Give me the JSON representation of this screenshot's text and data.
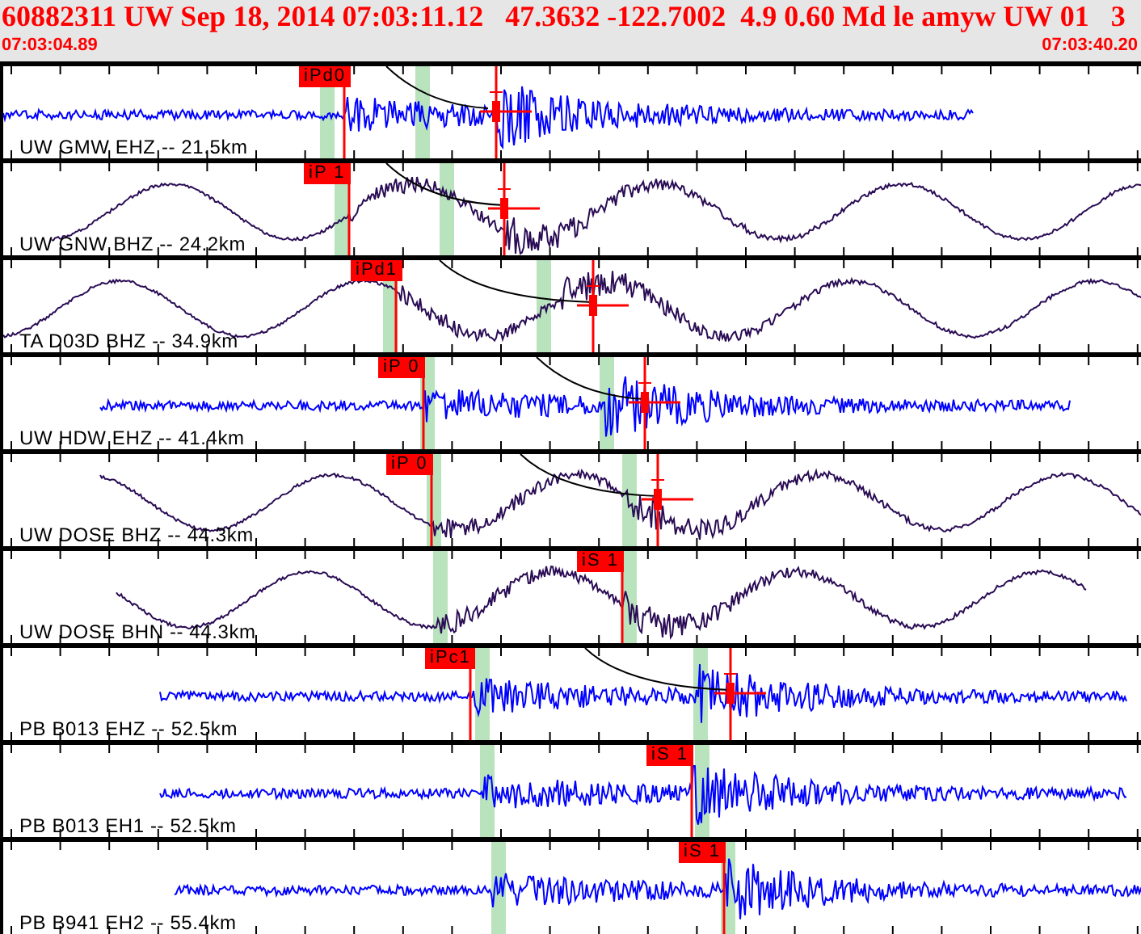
{
  "header": {
    "title": "60882311 UW Sep 18, 2014 07:03:11.12   47.3632 -122.7002  4.9 0.60 Md le amyw UW 01   3",
    "start_time": "07:03:04.89",
    "end_time": "07:03:40.20"
  },
  "traces": [
    {
      "label": "UW GMW EHZ -- 21.5km",
      "kind": "short-period",
      "color": "#0000ff",
      "pick": "iPd0"
    },
    {
      "label": "UW GNW BHZ -- 24.2km",
      "kind": "broadband",
      "color": "#2a0c55",
      "pick": "iP 1"
    },
    {
      "label": "TA D03D BHZ -- 34.9km",
      "kind": "broadband",
      "color": "#2a0c55",
      "pick": "iPd1"
    },
    {
      "label": "UW HDW EHZ -- 41.4km",
      "kind": "short-period",
      "color": "#0000ff",
      "pick": "iP 0"
    },
    {
      "label": "UW DOSE BHZ -- 44.3km",
      "kind": "broadband",
      "color": "#2a0c55",
      "pick": "iP 0"
    },
    {
      "label": "UW DOSE BHN -- 44.3km",
      "kind": "broadband",
      "color": "#2a0c55",
      "pick": "iS 1"
    },
    {
      "label": "PB B013 EHZ -- 52.5km",
      "kind": "short-period",
      "color": "#0000ff",
      "pick": "iPc1"
    },
    {
      "label": "PB B013 EH1 -- 52.5km",
      "kind": "short-period",
      "color": "#0000ff",
      "pick": "iS 1"
    },
    {
      "label": "PB B941 EH2 -- 55.4km",
      "kind": "short-period",
      "color": "#0000ff",
      "pick": "iS 1"
    }
  ]
}
